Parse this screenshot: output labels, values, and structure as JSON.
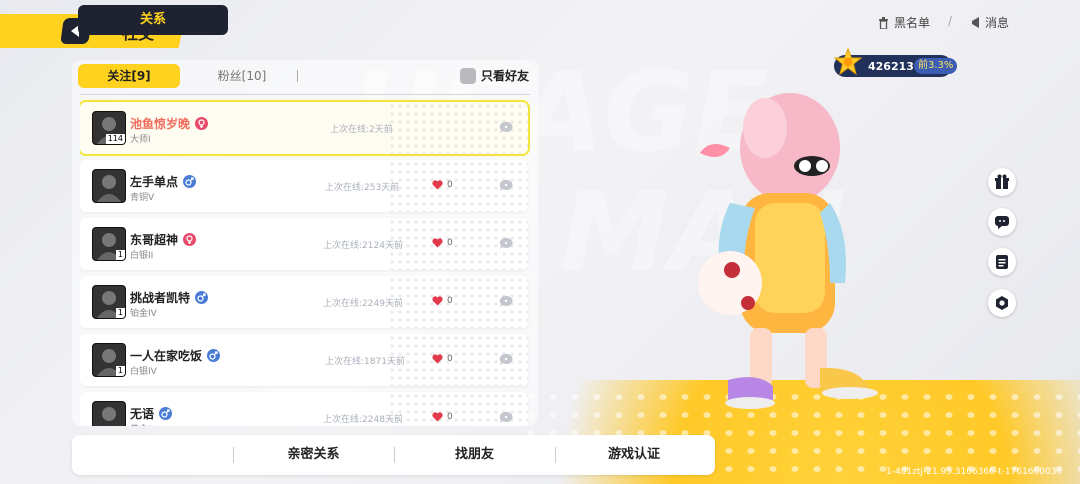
{
  "header": {
    "title": "社交",
    "blacklist_label": "黑名单",
    "messages_label": "消息"
  },
  "score": {
    "value": "426213",
    "rank": "前3.3%"
  },
  "tabs": {
    "follow": "关注[9]",
    "fans": "粉丝[10]",
    "friends_only": "只看好友"
  },
  "friends": [
    {
      "name": "池鱼惊岁晚",
      "gender": "female",
      "rank": "大师I",
      "level": "114",
      "online": "上次在线:2天前",
      "likes": "",
      "selected": true
    },
    {
      "name": "左手单点",
      "gender": "male",
      "rank": "青铜V",
      "level": "",
      "online": "上次在线:253天前",
      "likes": "0",
      "selected": false
    },
    {
      "name": "东哥超神",
      "gender": "female",
      "rank": "白银II",
      "level": "1",
      "online": "上次在线:2124天前",
      "likes": "0",
      "selected": false
    },
    {
      "name": "挑战者凯特",
      "gender": "male",
      "rank": "铂金IV",
      "level": "1",
      "online": "上次在线:2249天前",
      "likes": "0",
      "selected": false
    },
    {
      "name": "一人在家吃饭",
      "gender": "male",
      "rank": "白银IV",
      "level": "1",
      "online": "上次在线:1871天前",
      "likes": "0",
      "selected": false
    },
    {
      "name": "无语",
      "gender": "male",
      "rank": "黄金II",
      "level": "",
      "online": "上次在线:2248天前",
      "likes": "0",
      "selected": false
    }
  ],
  "bottom_nav": [
    "关系",
    "亲密关系",
    "找朋友",
    "游戏认证"
  ],
  "side_icons": [
    "gift-icon",
    "chat-icon",
    "notes-icon",
    "settings-icon"
  ],
  "footer_id": "1-481ztj-21.95.3106366-t-1761660036",
  "colors": {
    "accent": "#ffd21f",
    "dark": "#1f2331",
    "highlight_name": "#f06a5a"
  }
}
